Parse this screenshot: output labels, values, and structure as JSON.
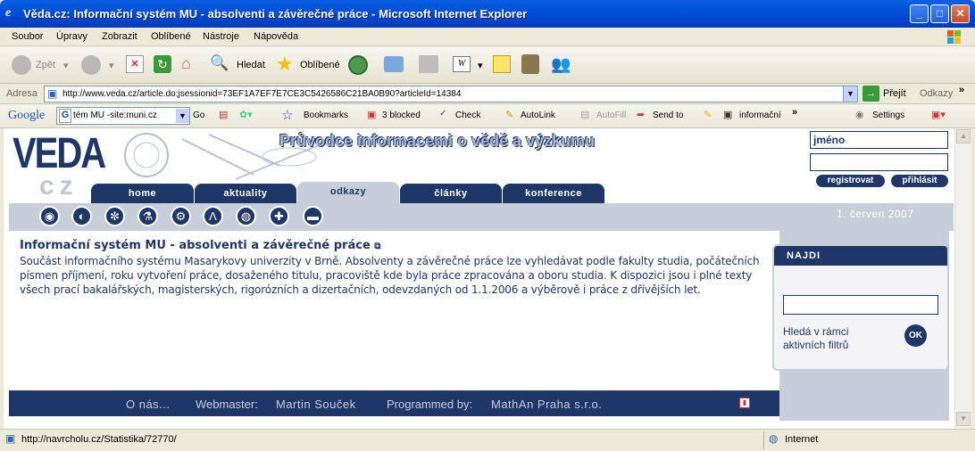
{
  "window": {
    "title": "Věda.cz: Informační systém MU - absolventi a závěrečné práce - Microsoft Internet Explorer"
  },
  "menu": [
    "Soubor",
    "Úpravy",
    "Zobrazit",
    "Oblíbené",
    "Nástroje",
    "Nápověda"
  ],
  "toolbar": {
    "back": "Zpět",
    "search": "Hledat",
    "favorites": "Oblíbené"
  },
  "address": {
    "label": "Adresa",
    "url": "http://www.veda.cz/article.do;jsessionid=73EF1A7EF7E7CE3C5426586C21BA0B90?articleId=14384",
    "go": "Přejít",
    "links": "Odkazy"
  },
  "google_bar": {
    "logo": "Google",
    "query": "tém MU -site:muni.cz",
    "go": "Go",
    "bookmarks": "Bookmarks",
    "blocked": "3 blocked",
    "check": "Check",
    "autolink": "AutoLink",
    "autofill": "AutoFill",
    "sendto": "Send to",
    "info": "informační",
    "settings": "Settings"
  },
  "site": {
    "logo_top": "VEDA",
    "logo_bottom": "cz",
    "tagline": "Průvodce informacemi o vědě a výzkumu",
    "name_field": "jméno",
    "register": "registrovat",
    "login": "přihlásit",
    "tabs": [
      {
        "label": "home"
      },
      {
        "label": "aktuality"
      },
      {
        "label": "odkazy"
      },
      {
        "label": "články"
      },
      {
        "label": "konference"
      }
    ],
    "date": "1. červen 2007",
    "article_title": "Informační systém MU - absolventi a závěrečné práce",
    "article_text": "Součást informačního systému Masarykovy univerzity v Brně. Absolventy a závěrečné práce lze vyhledávat podle fakulty studia, počátečních písmen příjmení, roku vytvoření práce, dosaženého titulu, pracoviště kde byla práce zpracována a oboru studia. K dispozici jsou i plné texty všech prací bakalářských, magisterských, rigorózních a dizertačních, odevzdaných od 1.1.2006 a výběrově i práce z dřívějších let.",
    "search_title": "NAJDI",
    "search_hint": "Hledá v rámci aktivních filtrů",
    "ok": "OK",
    "footer": {
      "about": "O nás...",
      "webmaster_label": "Webmaster:",
      "webmaster": "Martin Souček",
      "programmed_label": "Programmed by:",
      "programmed": "MathAn Praha s.r.o."
    }
  },
  "status": {
    "url": "http://navrcholu.cz/Statistika/72770/",
    "zone": "Internet"
  }
}
